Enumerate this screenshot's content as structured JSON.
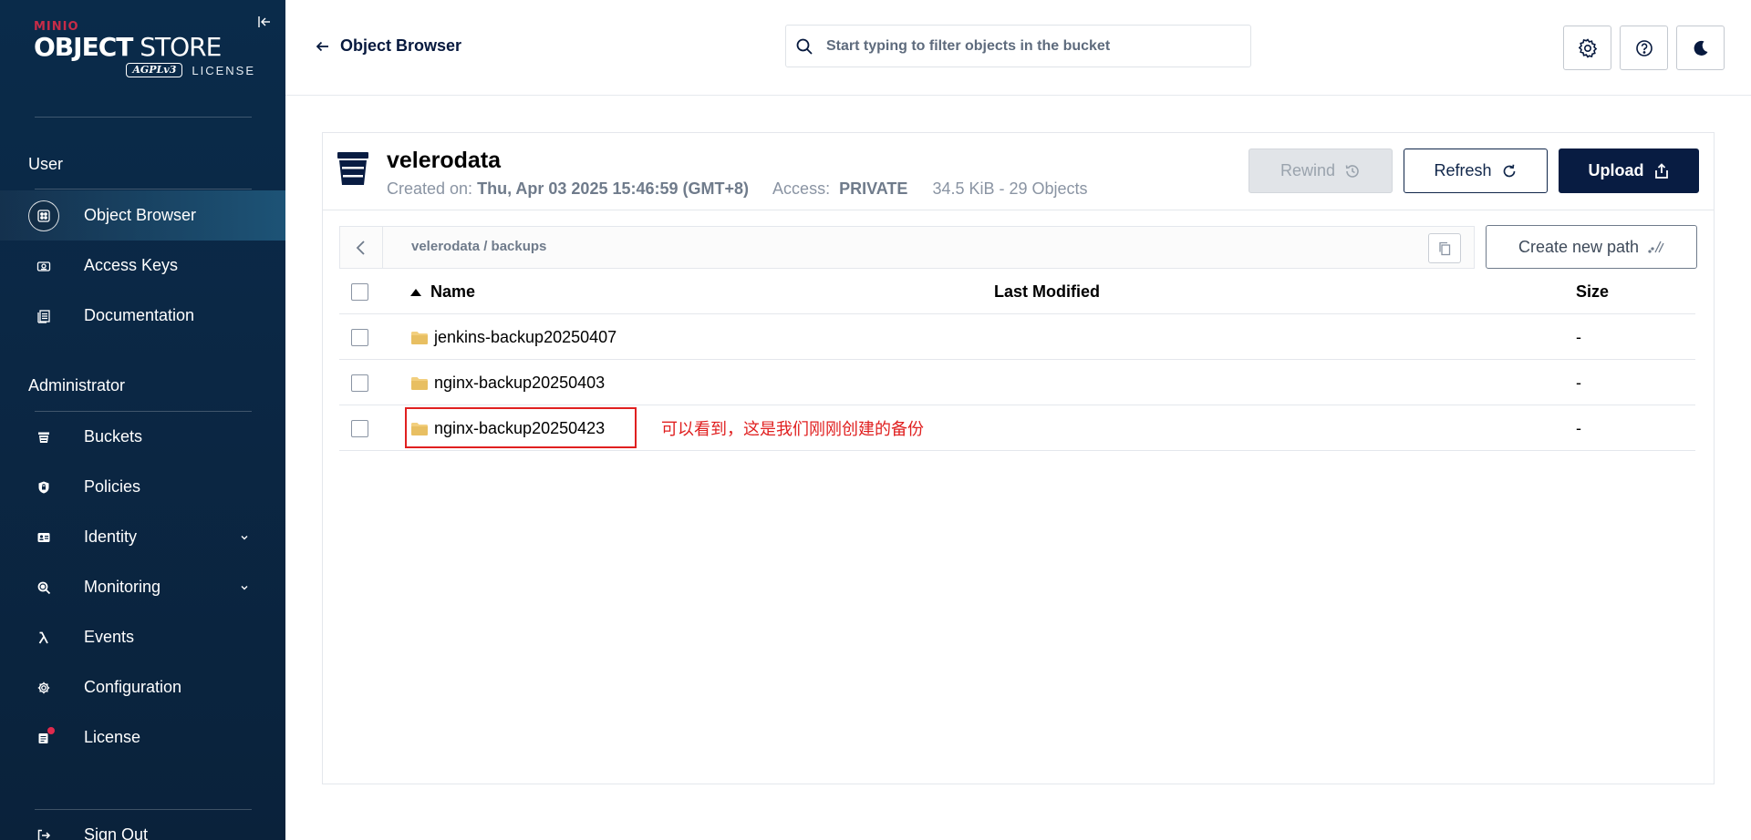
{
  "sidebar": {
    "logo": {
      "brand": "MINIO",
      "product_bold": "OBJECT",
      "product_light": " STORE",
      "badge": "AGPLv3",
      "license_label": "LICENSE"
    },
    "sections": [
      {
        "title": "User",
        "items": [
          {
            "label": "Object Browser",
            "icon": "object-browser-icon",
            "active": true
          },
          {
            "label": "Access Keys",
            "icon": "access-keys-icon"
          },
          {
            "label": "Documentation",
            "icon": "documentation-icon"
          }
        ]
      },
      {
        "title": "Administrator",
        "items": [
          {
            "label": "Buckets",
            "icon": "buckets-icon"
          },
          {
            "label": "Policies",
            "icon": "policies-icon"
          },
          {
            "label": "Identity",
            "icon": "identity-icon",
            "expandable": true
          },
          {
            "label": "Monitoring",
            "icon": "monitoring-icon",
            "expandable": true
          },
          {
            "label": "Events",
            "icon": "lambda-icon"
          },
          {
            "label": "Configuration",
            "icon": "gear-icon"
          },
          {
            "label": "License",
            "icon": "license-icon"
          }
        ]
      }
    ],
    "sign_out": "Sign Out"
  },
  "topbar": {
    "back_label": "Object Browser",
    "search_placeholder": "Start typing to filter objects in the bucket"
  },
  "bucket": {
    "name": "velerodata",
    "created_label": "Created on:",
    "created_value": "Thu, Apr 03 2025 15:46:59 (GMT+8)",
    "access_label": "Access:",
    "access_value": "PRIVATE",
    "usage": "34.5 KiB - 29 Objects"
  },
  "actions": {
    "rewind": "Rewind",
    "refresh": "Refresh",
    "upload": "Upload",
    "create_path": "Create new path"
  },
  "breadcrumb": {
    "path": "velerodata / backups"
  },
  "table": {
    "columns": {
      "name": "Name",
      "modified": "Last Modified",
      "size": "Size"
    },
    "rows": [
      {
        "name": "jenkins-backup20250407",
        "modified": "",
        "size": "-"
      },
      {
        "name": "nginx-backup20250403",
        "modified": "",
        "size": "-"
      },
      {
        "name": "nginx-backup20250423",
        "modified": "",
        "size": "-"
      }
    ]
  },
  "annotation": {
    "text": "可以看到，这是我们刚刚创建的备份"
  },
  "colors": {
    "sidebar_bg": "#0b2744",
    "primary": "#081c42",
    "annotation": "#e02020",
    "accent_red": "#c72c48"
  }
}
